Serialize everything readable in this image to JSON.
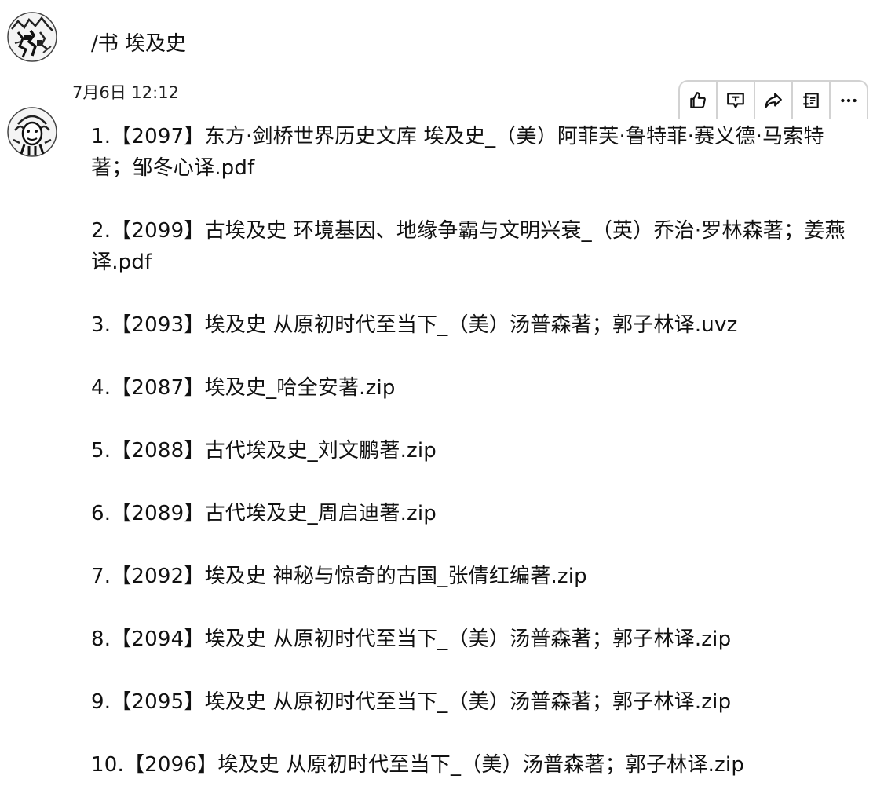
{
  "message_top": {
    "text": "/书 埃及史"
  },
  "message_reply": {
    "timestamp": "7月6日 12:12",
    "items": [
      "1.【2097】东方·剑桥世界历史文库  埃及史_（美）阿菲芙·鲁特菲·赛义德·马索特著；邹冬心译.pdf",
      "2.【2099】古埃及史  环境基因、地缘争霸与文明兴衰_（英）乔治·罗林森著；姜燕译.pdf",
      "3.【2093】埃及史  从原初时代至当下_（美）汤普森著；郭子林译.uvz",
      "4.【2087】埃及史_哈全安著.zip",
      "5.【2088】古代埃及史_刘文鹏著.zip",
      "6.【2089】古代埃及史_周启迪著.zip",
      "7.【2092】埃及史  神秘与惊奇的古国_张倩红编著.zip",
      "8.【2094】埃及史  从原初时代至当下_（美）汤普森著；郭子林译.zip",
      "9.【2095】埃及史  从原初时代至当下_（美）汤普森著；郭子林译.zip",
      "10.【2096】埃及史  从原初时代至当下_（美）汤普森著；郭子林译.zip"
    ]
  },
  "toolbar": {
    "icons": [
      "thumbs-up-icon",
      "quote-reply-icon",
      "share-icon",
      "bookmark-icon",
      "more-icon"
    ]
  }
}
